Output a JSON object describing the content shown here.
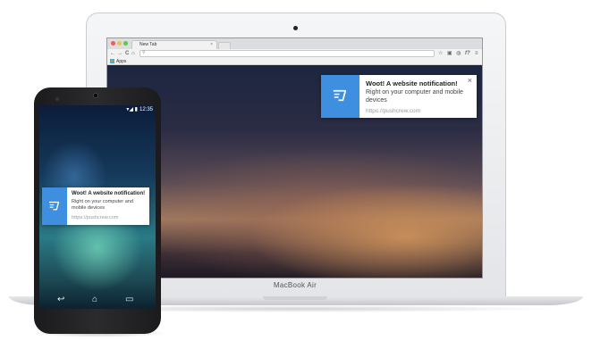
{
  "laptop": {
    "browser": {
      "tab_title": "New Tab",
      "tab_close": "×",
      "nav": {
        "back": "←",
        "forward": "→",
        "reload": "C",
        "home": "⌂"
      },
      "omnibox_icon": "search-icon",
      "bookmarks_bar": {
        "apps_label": "Apps"
      }
    },
    "bezel_label": "MacBook Air",
    "notification": {
      "icon": "pushcrew-logo-icon",
      "title": "Woot! A website notification!",
      "body": "Right on your computer and mobile devices",
      "url": "https://pushcrew.com",
      "close": "×",
      "accent_color": "#3f8fe0"
    }
  },
  "phone": {
    "status_bar": {
      "time": "12:35",
      "icons": "▾◢ ▮"
    },
    "notification": {
      "icon": "pushcrew-logo-icon",
      "title": "Woot! A website notification!",
      "body": "Right on your computer and mobile devices",
      "url": "https://pushcrew.com",
      "accent_color": "#3f8fe0"
    },
    "nav_bar": {
      "back": "↩",
      "home": "⌂",
      "recents": "▭"
    }
  }
}
